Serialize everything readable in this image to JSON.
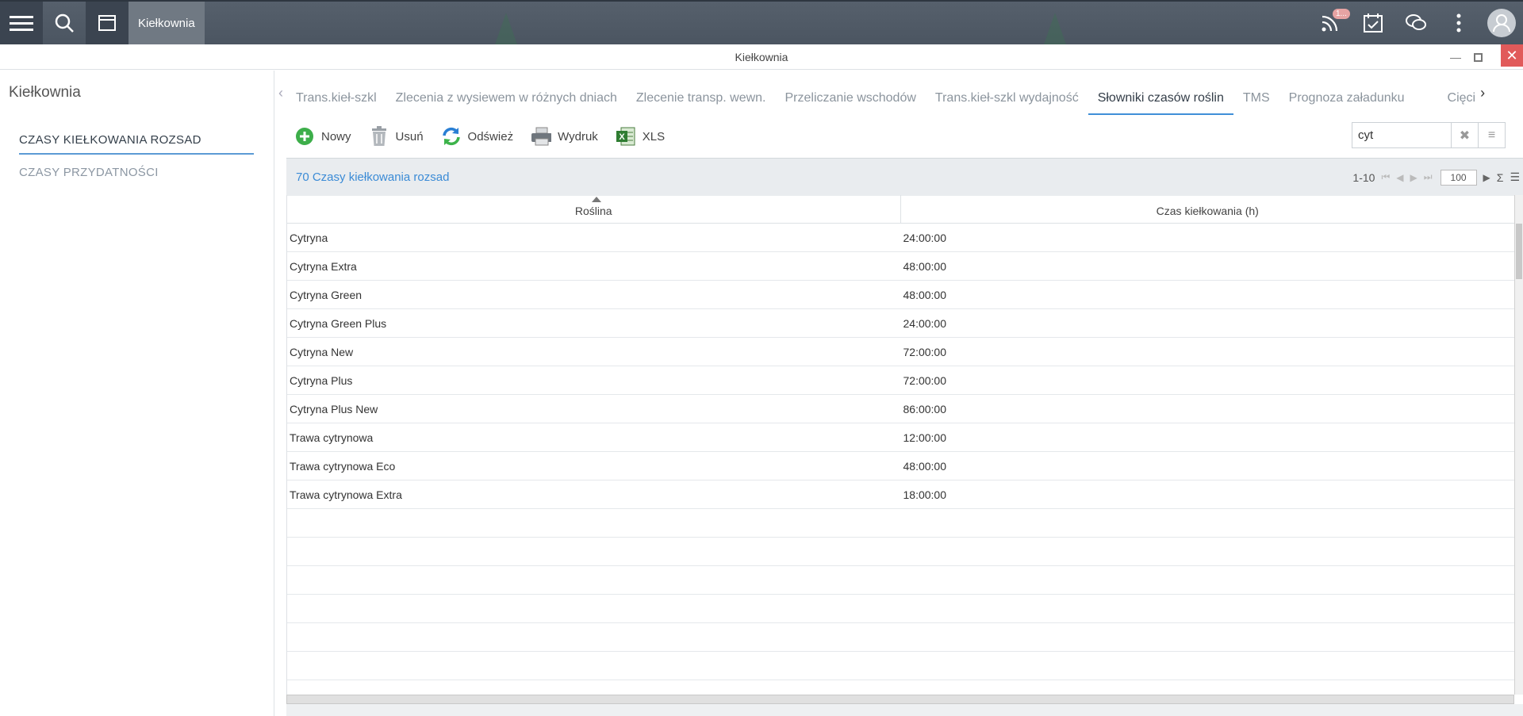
{
  "topbar": {
    "app_label": "Kiełkownia",
    "notification_badge": "1..."
  },
  "window": {
    "title": "Kiełkownia"
  },
  "sidebar": {
    "title": "Kiełkownia",
    "items": [
      {
        "label": "CZASY KIEŁKOWANIA ROZSAD",
        "active": true
      },
      {
        "label": "CZASY PRZYDATNOŚCI",
        "active": false
      }
    ]
  },
  "tabs": [
    {
      "label": "Trans.kieł-szkl",
      "active": false
    },
    {
      "label": "Zlecenia z wysiewem w różnych dniach",
      "active": false
    },
    {
      "label": "Zlecenie transp. wewn.",
      "active": false
    },
    {
      "label": "Przeliczanie wschodów",
      "active": false
    },
    {
      "label": "Trans.kieł-szkl wydajność",
      "active": false
    },
    {
      "label": "Słowniki czasów roślin",
      "active": true
    },
    {
      "label": "TMS",
      "active": false
    },
    {
      "label": "Prognoza załadunku",
      "active": false
    },
    {
      "label": "Cięci",
      "active": false
    }
  ],
  "toolbar": {
    "new_label": "Nowy",
    "delete_label": "Usuń",
    "refresh_label": "Odśwież",
    "print_label": "Wydruk",
    "xls_label": "XLS",
    "search_value": "cyt"
  },
  "grid": {
    "count_label": "70 Czasy kiełkowania rozsad",
    "range_label": "1-10",
    "page_size": "100",
    "columns": [
      "Roślina",
      "Czas kiełkowania (h)"
    ],
    "rows": [
      [
        "Cytryna",
        "24:00:00"
      ],
      [
        "Cytryna Extra",
        "48:00:00"
      ],
      [
        "Cytryna Green",
        "48:00:00"
      ],
      [
        "Cytryna Green Plus",
        "24:00:00"
      ],
      [
        "Cytryna New",
        "72:00:00"
      ],
      [
        "Cytryna Plus",
        "72:00:00"
      ],
      [
        "Cytryna Plus New",
        "86:00:00"
      ],
      [
        "Trawa cytrynowa",
        "12:00:00"
      ],
      [
        "Trawa cytrynowa Eco",
        "48:00:00"
      ],
      [
        "Trawa cytrynowa Extra",
        "18:00:00"
      ]
    ]
  },
  "colors": {
    "accent": "#3f8fd8",
    "topbar": "#4f5965",
    "close": "#e15a5a",
    "new_icon": "#3dae4a"
  }
}
